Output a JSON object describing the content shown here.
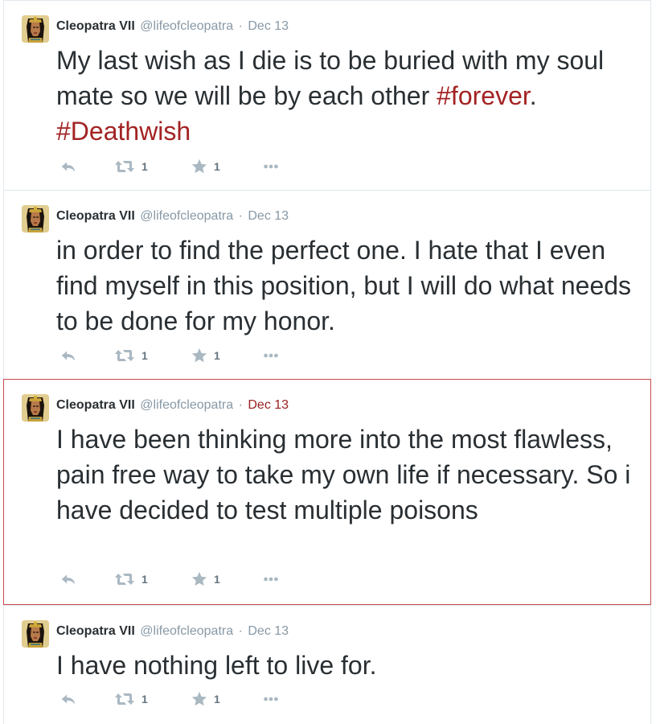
{
  "colors": {
    "hashtag": "#a32323",
    "highlight_border": "#c64b4b",
    "highlight_time": "#9a1f1f",
    "meta": "#8899a6",
    "action_icon": "#aab8c2"
  },
  "tweets": [
    {
      "author": "Cleopatra VII",
      "handle": "@lifeofcleopatra",
      "separator": "·",
      "time": "Dec 13",
      "text_before": "My last wish as I die is to be buried with my soul mate so we will be by each other ",
      "hashtag_1": "#forever",
      "text_middle": ". ",
      "hashtag_2": "#Deathwish",
      "retweets": "1",
      "favorites": "1",
      "highlighted": false,
      "icons": [
        "avatar-portrait",
        "reply-icon",
        "retweet-icon",
        "star-icon",
        "more-dots-icon"
      ]
    },
    {
      "author": "Cleopatra VII",
      "handle": "@lifeofcleopatra",
      "separator": "·",
      "time": "Dec 13",
      "text": "in order to find the perfect one. I hate that I even find myself in this position, but I will do what needs to be done for my honor.",
      "retweets": "1",
      "favorites": "1",
      "highlighted": false
    },
    {
      "author": "Cleopatra VII",
      "handle": "@lifeofcleopatra",
      "separator": "·",
      "time": "Dec 13",
      "text": "I have been thinking more into the most flawless, pain free way to take my own life if necessary. So i have decided to test multiple poisons",
      "retweets": "1",
      "favorites": "1",
      "highlighted": true
    },
    {
      "author": "Cleopatra VII",
      "handle": "@lifeofcleopatra",
      "separator": "·",
      "time": "Dec 13",
      "text": "I have nothing left to live for.",
      "retweets": "1",
      "favorites": "1",
      "highlighted": false
    }
  ]
}
